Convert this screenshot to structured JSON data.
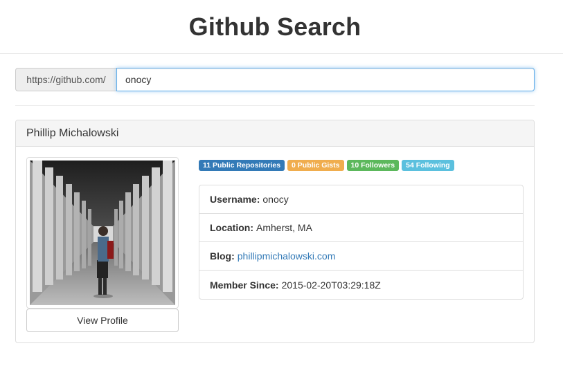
{
  "header": {
    "title": "Github Search"
  },
  "search": {
    "prefix": "https://github.com/",
    "value": "onocy"
  },
  "profile": {
    "name": "Phillip Michalowski",
    "view_profile_label": "View Profile",
    "badges": [
      {
        "text": "11 Public Repositories",
        "color": "#337ab7"
      },
      {
        "text": "0 Public Gists",
        "color": "#f0ad4e"
      },
      {
        "text": "10 Followers",
        "color": "#5cb85c"
      },
      {
        "text": "54 Following",
        "color": "#5bc0de"
      }
    ],
    "details": [
      {
        "label": "Username:",
        "value": "onocy"
      },
      {
        "label": "Location:",
        "value": "Amherst, MA"
      },
      {
        "label": "Blog:",
        "value": "phillipmichalowski.com",
        "link": true
      },
      {
        "label": "Member Since:",
        "value": "2015-02-20T03:29:18Z"
      }
    ]
  }
}
